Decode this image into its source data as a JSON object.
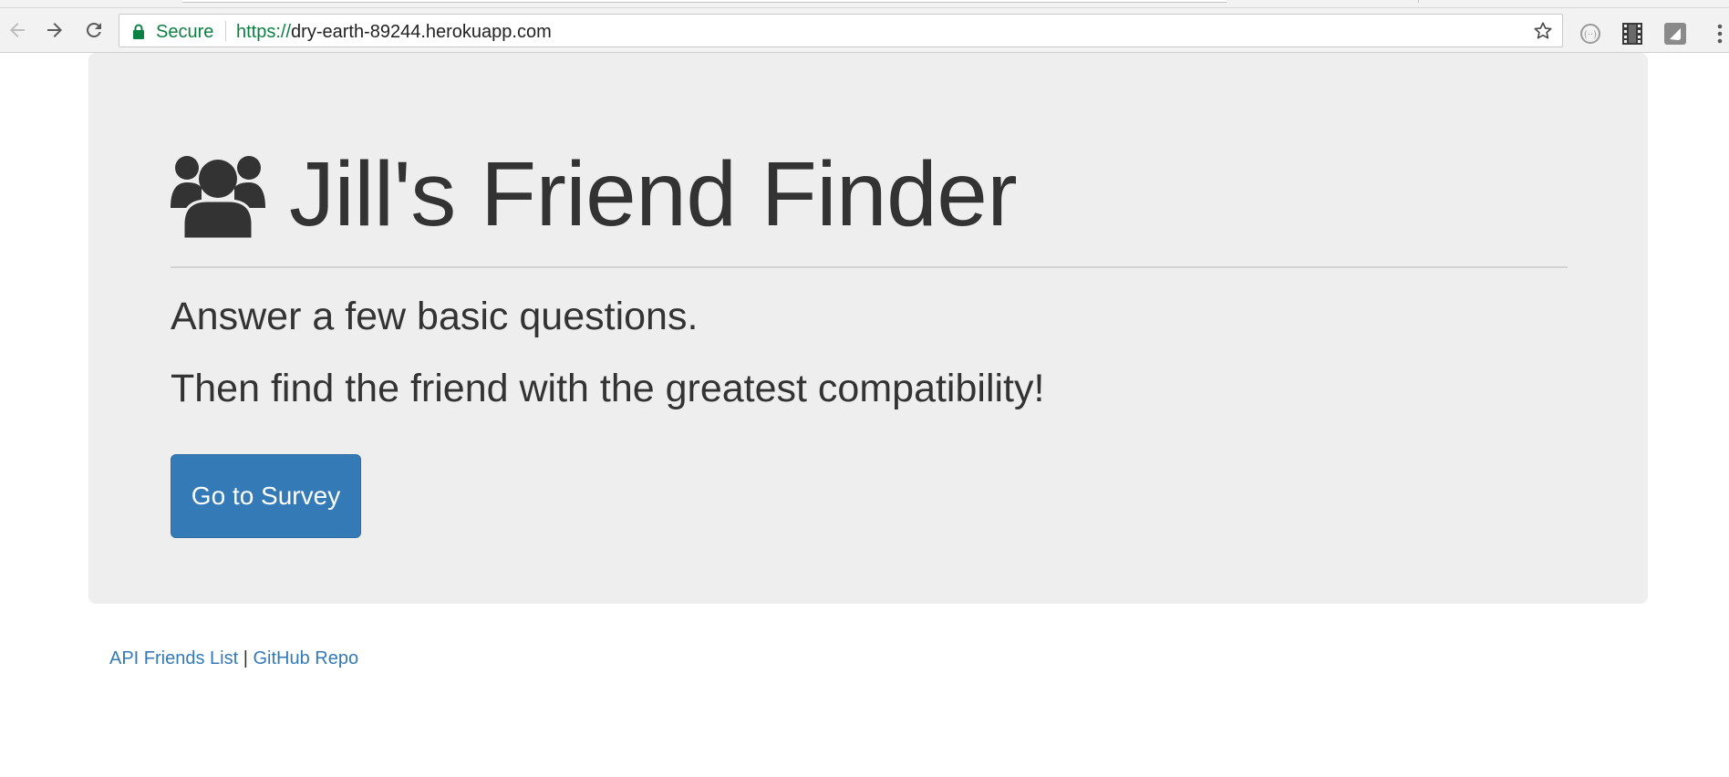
{
  "browser": {
    "security_label": "Secure",
    "url_scheme": "https://",
    "url_host": "dry-earth-89244.herokuapp.com",
    "icons": [
      "back-arrow-icon",
      "forward-arrow-icon",
      "reload-icon",
      "lock-icon",
      "star-icon",
      "extension-icon",
      "film-icon",
      "shield-extension-icon",
      "menu-dots-icon"
    ],
    "secure_color": "#0b8043"
  },
  "hero": {
    "icon": "users-icon",
    "title": "Jill's Friend Finder",
    "lead_1": "Answer a few basic questions.",
    "lead_2": "Then find the friend with the greatest compatibility!",
    "button_label": "Go to Survey",
    "button_color": "#337ab7",
    "background_color": "#eeeeee"
  },
  "footer": {
    "link_api": "API Friends List",
    "separator": "|",
    "link_github": "GitHub Repo",
    "link_color": "#337ab7"
  }
}
